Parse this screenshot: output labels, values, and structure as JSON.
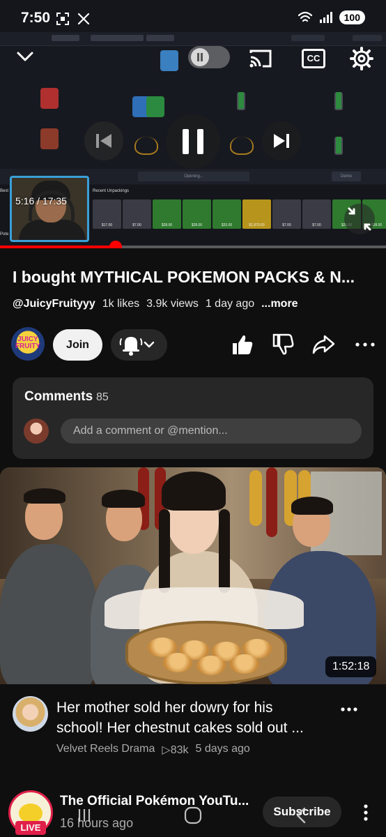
{
  "status_bar": {
    "time": "7:50",
    "left_icons": [
      "screenshot-icon",
      "x-logo-icon"
    ],
    "right_icons": [
      "wifi-icon",
      "signal-icon"
    ],
    "battery": "100"
  },
  "player": {
    "scrub_time": "5:16 / 17:35",
    "progress_fraction": 0.3,
    "controls": [
      "collapse-chevron-icon",
      "autoplay-toggle",
      "cast-icon",
      "captions-icon",
      "settings-gear-icon",
      "previous-icon",
      "pause-icon",
      "next-icon",
      "fullscreen-exit-icon"
    ],
    "captions_label": "CC",
    "game": {
      "best_label": "Best",
      "recent_label": "Recent Unpackings",
      "pote_label": "Pote",
      "opening_label": "Opening...",
      "demo_label": "Demo",
      "recent_items": [
        {
          "price": "$17.00",
          "color": "#3a3b44"
        },
        {
          "price": "$7.00",
          "color": "#3a3b44"
        },
        {
          "price": "$28.00",
          "color": "#2f7a2e"
        },
        {
          "price": "$28.00",
          "color": "#2f7a2e"
        },
        {
          "price": "$33.00",
          "color": "#2f7a2e"
        },
        {
          "price": "$1,870.00",
          "color": "#b7951c"
        },
        {
          "price": "$7.00",
          "color": "#3a3b44"
        },
        {
          "price": "$7.00",
          "color": "#3a3b44"
        },
        {
          "price": "$28.00",
          "color": "#2f7a2e"
        },
        {
          "price": "$28.00",
          "color": "#2f7a2e"
        }
      ]
    }
  },
  "video": {
    "title": "I bought MYTHICAL POKEMON PACKS & N...",
    "channel": "@JuicyFruityyy",
    "likes": "1k likes",
    "views": "3.9k views",
    "age": "1 day ago",
    "more": "...more"
  },
  "actions": {
    "channel_avatar_text": "JUICY FRUITY",
    "join": "Join",
    "icons": [
      "notifications-bell-icon",
      "like-icon",
      "dislike-icon",
      "share-icon",
      "more-icon"
    ]
  },
  "comments": {
    "label": "Comments",
    "count": "85",
    "placeholder": "Add a comment or @mention..."
  },
  "recommended": {
    "duration": "1:52:18",
    "title_line1": "Her mother sold her dowry for his",
    "title_line2": "school! Her chestnut cakes sold out ...",
    "channel": "Velvet Reels Drama",
    "views": "▷83k",
    "age": "5 days ago"
  },
  "next": {
    "live_label": "LIVE",
    "channel": "The Official Pokémon YouTu...",
    "time": "16 hours ago",
    "subscribe": "Subscribe"
  },
  "colors": {
    "background": "#0f0f0f",
    "accent_red": "#ff0000",
    "card": "#272727",
    "live_red": "#e0204a"
  }
}
